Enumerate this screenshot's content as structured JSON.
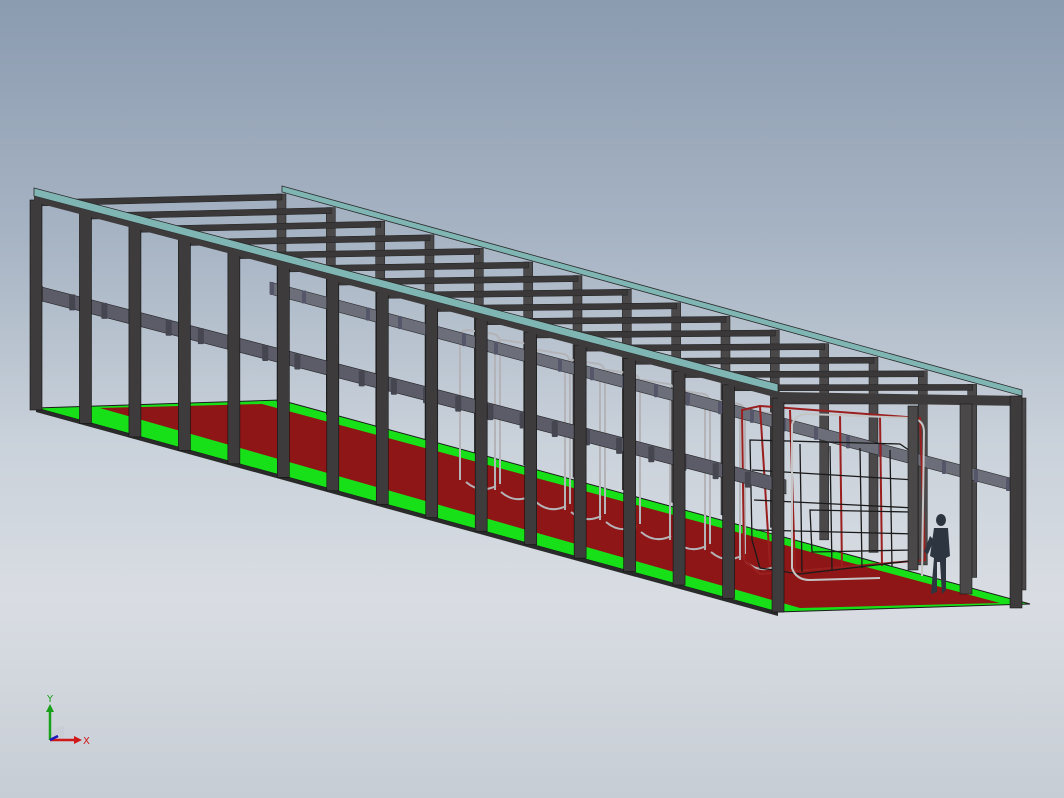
{
  "viewport": {
    "background_top": "#8b9bb0",
    "background_bottom": "#d9dde3"
  },
  "model": {
    "structure_color": "#3d3b3b",
    "roof_edge_color": "#7fb6b4",
    "floor_side_color": "#18e018",
    "floor_center_color": "#8e1616",
    "pipe_color": "#5b5c68",
    "bus_frame_color": "#1a1a1a",
    "bus_frame_accent": "#9a1f1f",
    "operator_color": "#2d3640"
  },
  "triad": {
    "x_label": "X",
    "y_label": "Y",
    "x_color": "#d01818",
    "y_color": "#18a018",
    "z_color": "#1818c0"
  }
}
